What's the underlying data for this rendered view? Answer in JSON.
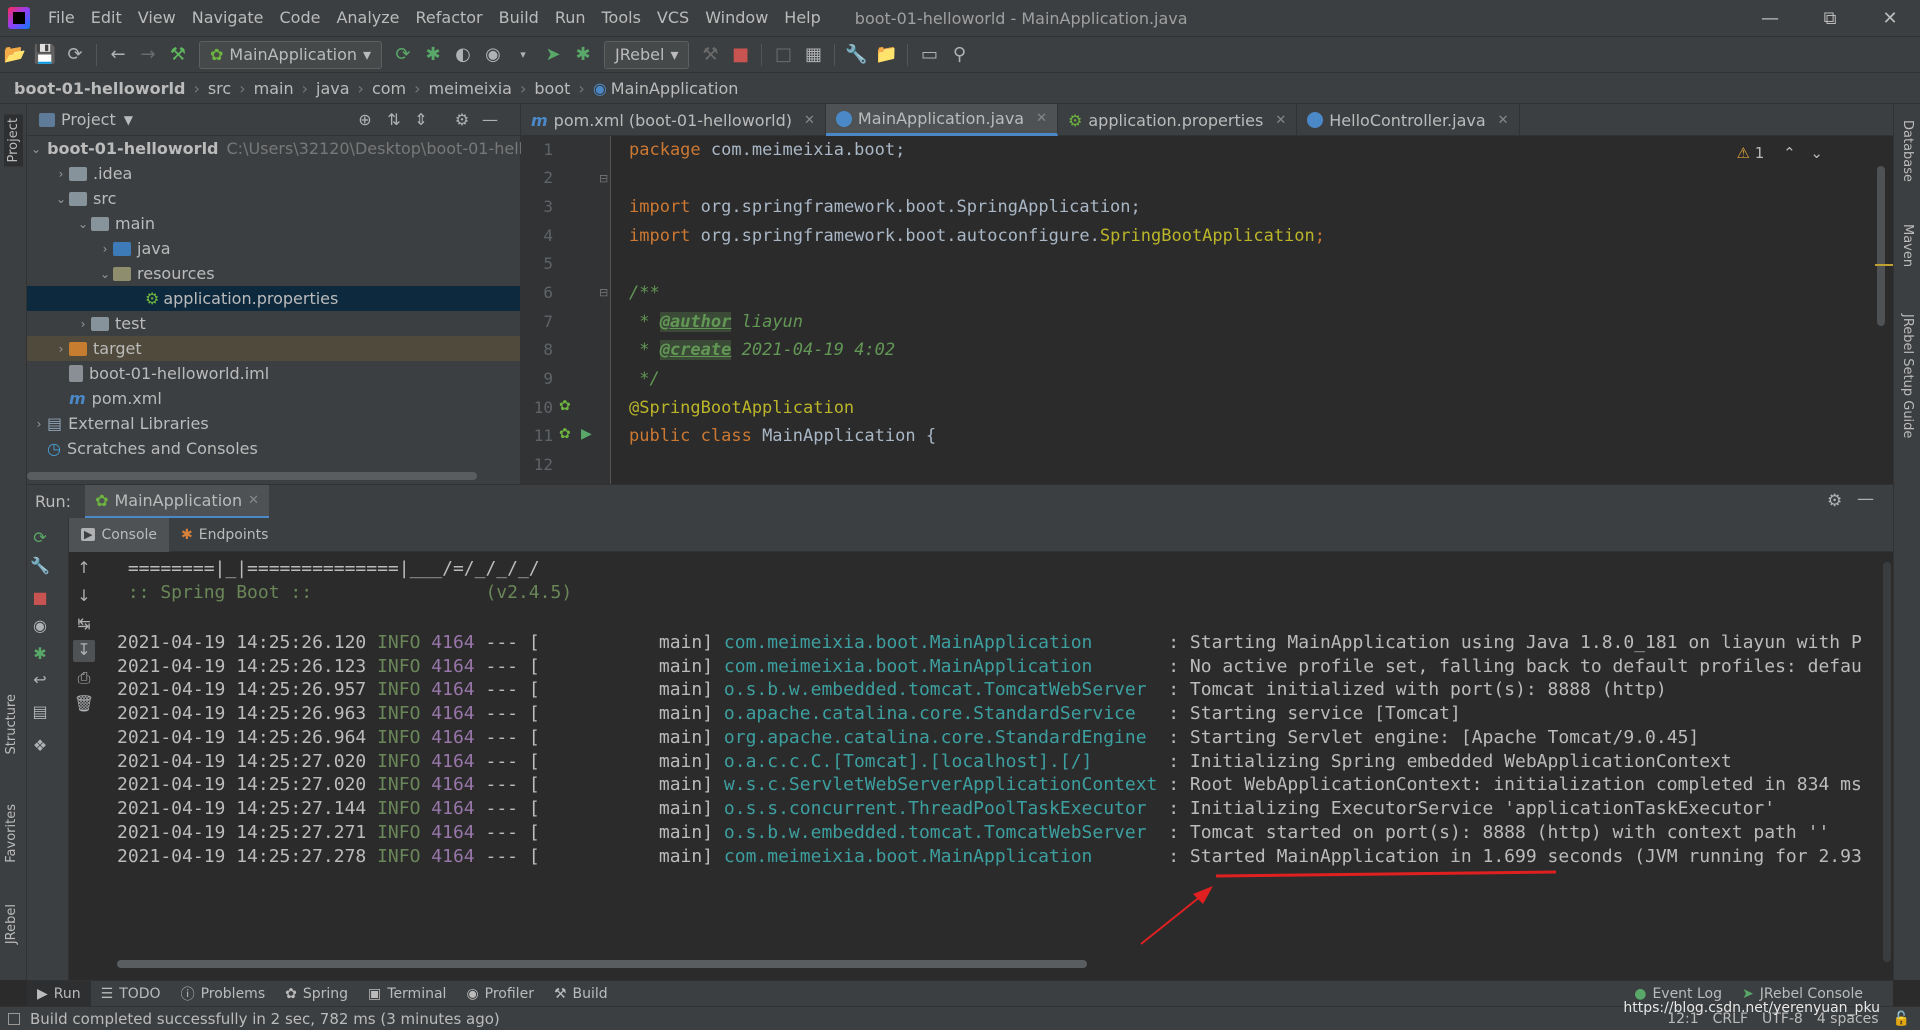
{
  "menu": {
    "items": [
      "File",
      "Edit",
      "View",
      "Navigate",
      "Code",
      "Analyze",
      "Refactor",
      "Build",
      "Run",
      "Tools",
      "VCS",
      "Window",
      "Help"
    ],
    "window_title": "boot-01-helloworld - MainApplication.java"
  },
  "toolbar": {
    "run_config": "MainApplication",
    "jrebel_combo": "JRebel"
  },
  "breadcrumb": [
    "boot-01-helloworld",
    "src",
    "main",
    "java",
    "com",
    "meimeixia",
    "boot",
    "MainApplication"
  ],
  "project": {
    "title": "Project",
    "tree": [
      {
        "label": "boot-01-helloworld",
        "hint": "C:\\Users\\32120\\Desktop\\boot-01-hello"
      },
      {
        "label": ".idea"
      },
      {
        "label": "src"
      },
      {
        "label": "main"
      },
      {
        "label": "java"
      },
      {
        "label": "resources"
      },
      {
        "label": "application.properties"
      },
      {
        "label": "test"
      },
      {
        "label": "target"
      },
      {
        "label": "boot-01-helloworld.iml"
      },
      {
        "label": "pom.xml"
      },
      {
        "label": "External Libraries"
      },
      {
        "label": "Scratches and Consoles"
      }
    ]
  },
  "editor_tabs": [
    {
      "label": "pom.xml (boot-01-helloworld)",
      "icon": "maven-icon"
    },
    {
      "label": "MainApplication.java",
      "icon": "spring-class-icon"
    },
    {
      "label": "application.properties",
      "icon": "spring-properties-icon"
    },
    {
      "label": "HelloController.java",
      "icon": "class-icon"
    }
  ],
  "editor": {
    "warning_count": "1",
    "line_numbers": [
      "1",
      "2",
      "3",
      "4",
      "5",
      "6",
      "7",
      "8",
      "9",
      "10",
      "11",
      "12"
    ],
    "lines": {
      "l1_kw": "package",
      "l1_rest": " com.meimeixia.boot;",
      "l3_kw": "import",
      "l3_rest": " org.springframework.boot.SpringApplication;",
      "l4_kw": "import",
      "l4_rest": " org.springframework.boot.autoconfigure.",
      "l4_ann": "SpringBootApplication",
      "l4_end": ";",
      "l6": "/**",
      "l7_pre": " * ",
      "l7_tag": "@author",
      "l7_val": " liayun",
      "l8_pre": " * ",
      "l8_tag": "@create",
      "l8_val": " 2021-04-19 4:02",
      "l9": " */",
      "l10": "@SpringBootApplication",
      "l11_kw": "public class",
      "l11_rest": " MainApplication {"
    }
  },
  "run": {
    "label": "Run:",
    "config": "MainApplication",
    "subtabs": [
      "Console",
      "Endpoints"
    ]
  },
  "console": {
    "banner1": " ========|_|==============|___/=/_/_/_/",
    "banner2": " :: Spring Boot ::                (v2.4.5)",
    "logs": [
      {
        "ts": "2021-04-19 14:25:26.120",
        "lvl": "INFO",
        "pid": "4164",
        "thread": " --- [           main] ",
        "logger": "com.meimeixia.boot.MainApplication      ",
        "msg": " : Starting MainApplication using Java 1.8.0_181 on liayun with P"
      },
      {
        "ts": "2021-04-19 14:25:26.123",
        "lvl": "INFO",
        "pid": "4164",
        "thread": " --- [           main] ",
        "logger": "com.meimeixia.boot.MainApplication      ",
        "msg": " : No active profile set, falling back to default profiles: defau"
      },
      {
        "ts": "2021-04-19 14:25:26.957",
        "lvl": "INFO",
        "pid": "4164",
        "thread": " --- [           main] ",
        "logger": "o.s.b.w.embedded.tomcat.TomcatWebServer ",
        "msg": " : Tomcat initialized with port(s): 8888 (http)"
      },
      {
        "ts": "2021-04-19 14:25:26.963",
        "lvl": "INFO",
        "pid": "4164",
        "thread": " --- [           main] ",
        "logger": "o.apache.catalina.core.StandardService  ",
        "msg": " : Starting service [Tomcat]"
      },
      {
        "ts": "2021-04-19 14:25:26.964",
        "lvl": "INFO",
        "pid": "4164",
        "thread": " --- [           main] ",
        "logger": "org.apache.catalina.core.StandardEngine ",
        "msg": " : Starting Servlet engine: [Apache Tomcat/9.0.45]"
      },
      {
        "ts": "2021-04-19 14:25:27.020",
        "lvl": "INFO",
        "pid": "4164",
        "thread": " --- [           main] ",
        "logger": "o.a.c.c.C.[Tomcat].[localhost].[/]      ",
        "msg": " : Initializing Spring embedded WebApplicationContext"
      },
      {
        "ts": "2021-04-19 14:25:27.020",
        "lvl": "INFO",
        "pid": "4164",
        "thread": " --- [           main] ",
        "logger": "w.s.c.ServletWebServerApplicationContext",
        "msg": " : Root WebApplicationContext: initialization completed in 834 ms"
      },
      {
        "ts": "2021-04-19 14:25:27.144",
        "lvl": "INFO",
        "pid": "4164",
        "thread": " --- [           main] ",
        "logger": "o.s.s.concurrent.ThreadPoolTaskExecutor ",
        "msg": " : Initializing ExecutorService 'applicationTaskExecutor'"
      },
      {
        "ts": "2021-04-19 14:25:27.271",
        "lvl": "INFO",
        "pid": "4164",
        "thread": " --- [           main] ",
        "logger": "o.s.b.w.embedded.tomcat.TomcatWebServer ",
        "msg": " : Tomcat started on port(s): 8888 (http) with context path ''"
      },
      {
        "ts": "2021-04-19 14:25:27.278",
        "lvl": "INFO",
        "pid": "4164",
        "thread": " --- [           main] ",
        "logger": "com.meimeixia.boot.MainApplication      ",
        "msg": " : Started MainApplication in 1.699 seconds (JVM running for 2.93"
      }
    ]
  },
  "side_tabs": {
    "left": [
      "Project",
      "Structure",
      "Favorites",
      "JRebel"
    ],
    "right": [
      "Database",
      "Maven",
      "JRebel Setup Guide"
    ]
  },
  "bottom_bar": {
    "left": [
      "Run",
      "TODO",
      "Problems",
      "Spring",
      "Terminal",
      "Profiler",
      "Build"
    ],
    "right": [
      "Event Log",
      "JRebel Console"
    ]
  },
  "status": {
    "message": "Build completed successfully in 2 sec, 782 ms (3 minutes ago)",
    "position": "12:1",
    "line_sep": "CRLF",
    "encoding": "UTF-8",
    "indent": "4 spaces"
  },
  "watermark": "https://blog.csdn.net/yerenyuan_pku",
  "colors": {
    "accent": "#4a88c7",
    "annotation_underline": "#e02020"
  }
}
